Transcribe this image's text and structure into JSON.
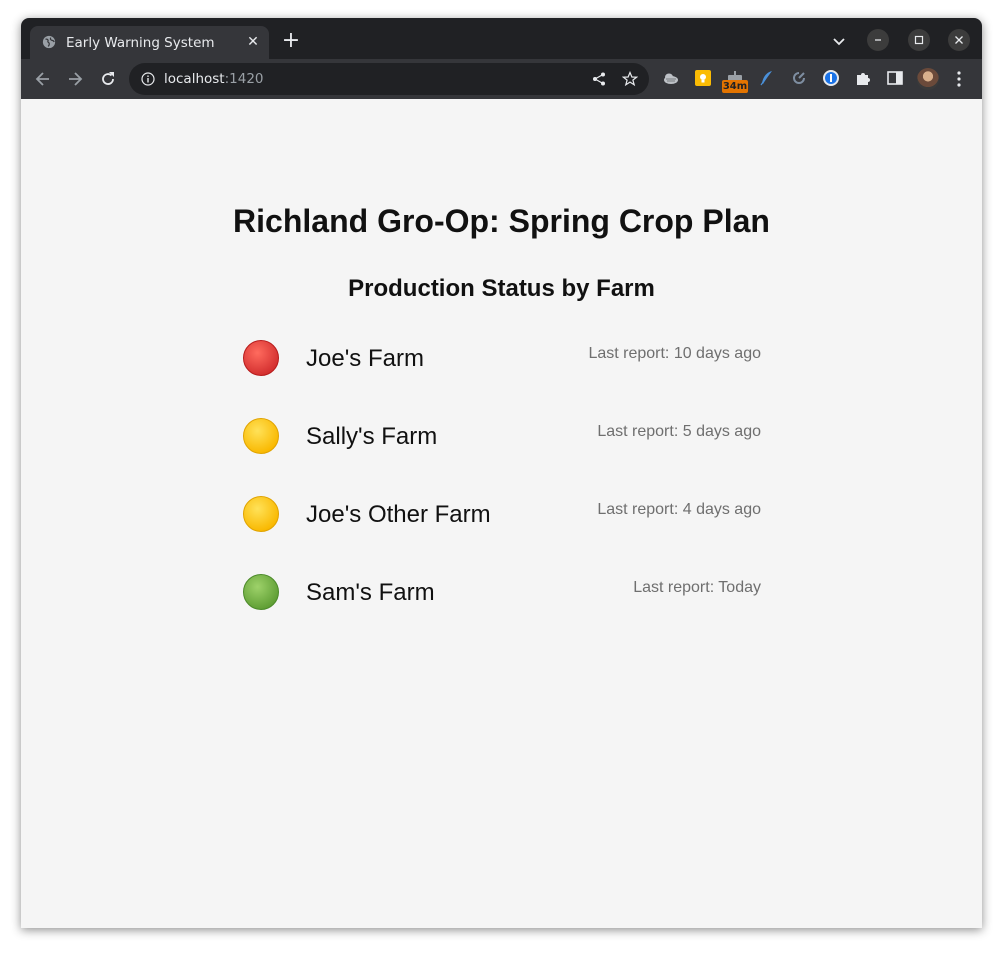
{
  "browser": {
    "tab": {
      "title": "Early Warning System",
      "favicon": "globe-icon"
    },
    "address": {
      "host": "localhost",
      "port": ":1420"
    },
    "extensions": {
      "badge_text": "34m"
    }
  },
  "page": {
    "title": "Richland Gro-Op: Spring Crop Plan",
    "section_title": "Production Status by Farm",
    "farms": [
      {
        "name": "Joe's Farm",
        "status": "red",
        "status_color": "#e53935",
        "last_report": "Last report: 10 days ago"
      },
      {
        "name": "Sally's Farm",
        "status": "yellow",
        "status_color": "#fdd835",
        "last_report": "Last report: 5 days ago"
      },
      {
        "name": "Joe's Other Farm",
        "status": "yellow",
        "status_color": "#fdd835",
        "last_report": "Last report: 4 days ago"
      },
      {
        "name": "Sam's Farm",
        "status": "green",
        "status_color": "#7cb342",
        "last_report": "Last report: Today"
      }
    ]
  },
  "colors": {
    "tabstrip_bg": "#202124",
    "toolbar_bg": "#35363a",
    "page_bg": "#f5f5f5",
    "report_text": "#6f6f6f"
  }
}
